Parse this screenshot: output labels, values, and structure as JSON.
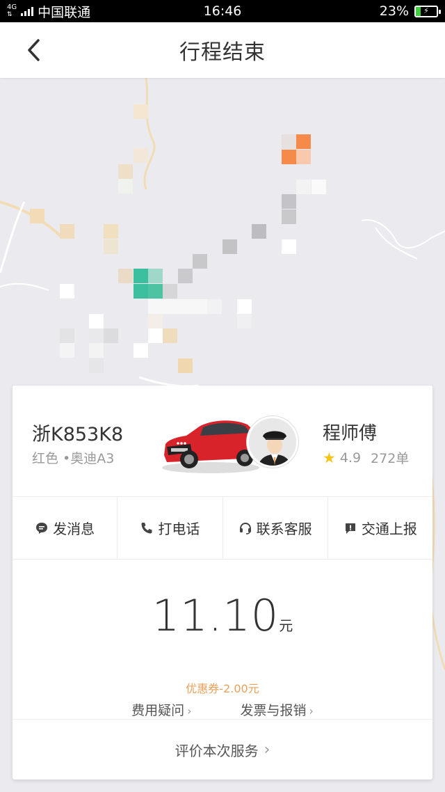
{
  "status_bar": {
    "network": "4G",
    "carrier": "中国联通",
    "time": "16:46",
    "battery": "23%",
    "battery_level": 0.23
  },
  "nav": {
    "title": "行程结束"
  },
  "driver_card": {
    "plate": "浙K853K8",
    "car_info": "红色 •奥迪A3",
    "driver_name": "程师傅",
    "rating": "4.9",
    "orders": "272单"
  },
  "actions": [
    {
      "label": "发消息",
      "icon": "message-icon"
    },
    {
      "label": "打电话",
      "icon": "phone-icon"
    },
    {
      "label": "联系客服",
      "icon": "headset-icon"
    },
    {
      "label": "交通上报",
      "icon": "report-icon"
    }
  ],
  "fare": {
    "amount": "11.10",
    "unit": "元",
    "coupon": "优惠券-2.00元",
    "fee_question": "费用疑问",
    "invoice": "发票与报销"
  },
  "rate_service": "评价本次服务",
  "colors": {
    "accent_orange": "#e8a05a",
    "star": "#f5c518",
    "car_red": "#d9232b",
    "route_green": "#3bbf9f"
  }
}
